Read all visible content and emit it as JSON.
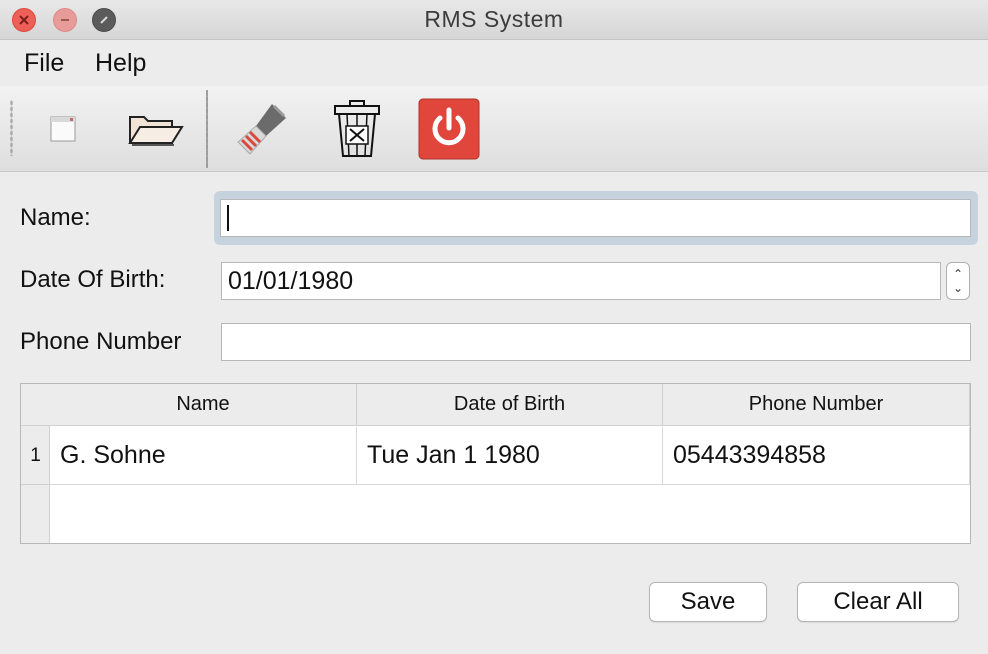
{
  "window": {
    "title": "RMS System"
  },
  "menu": {
    "items": [
      "File",
      "Help"
    ]
  },
  "toolbar": {
    "tools": [
      "new-document-icon",
      "open-folder-icon",
      "clear-brush-icon",
      "delete-trash-icon",
      "power-exit-icon"
    ],
    "accent_power": "#e0463b"
  },
  "form": {
    "name_label": "Name:",
    "name_value": "",
    "dob_label": "Date Of Birth:",
    "dob_value": "01/01/1980",
    "phone_label": "Phone Number",
    "phone_value": ""
  },
  "table": {
    "columns": [
      "Name",
      "Date of Birth",
      "Phone Number"
    ],
    "rows": [
      {
        "num": "1",
        "name": "G. Sohne",
        "dob": "Tue Jan 1 1980",
        "phone": "05443394858"
      }
    ]
  },
  "actions": {
    "save_label": "Save",
    "clear_label": "Clear All"
  }
}
